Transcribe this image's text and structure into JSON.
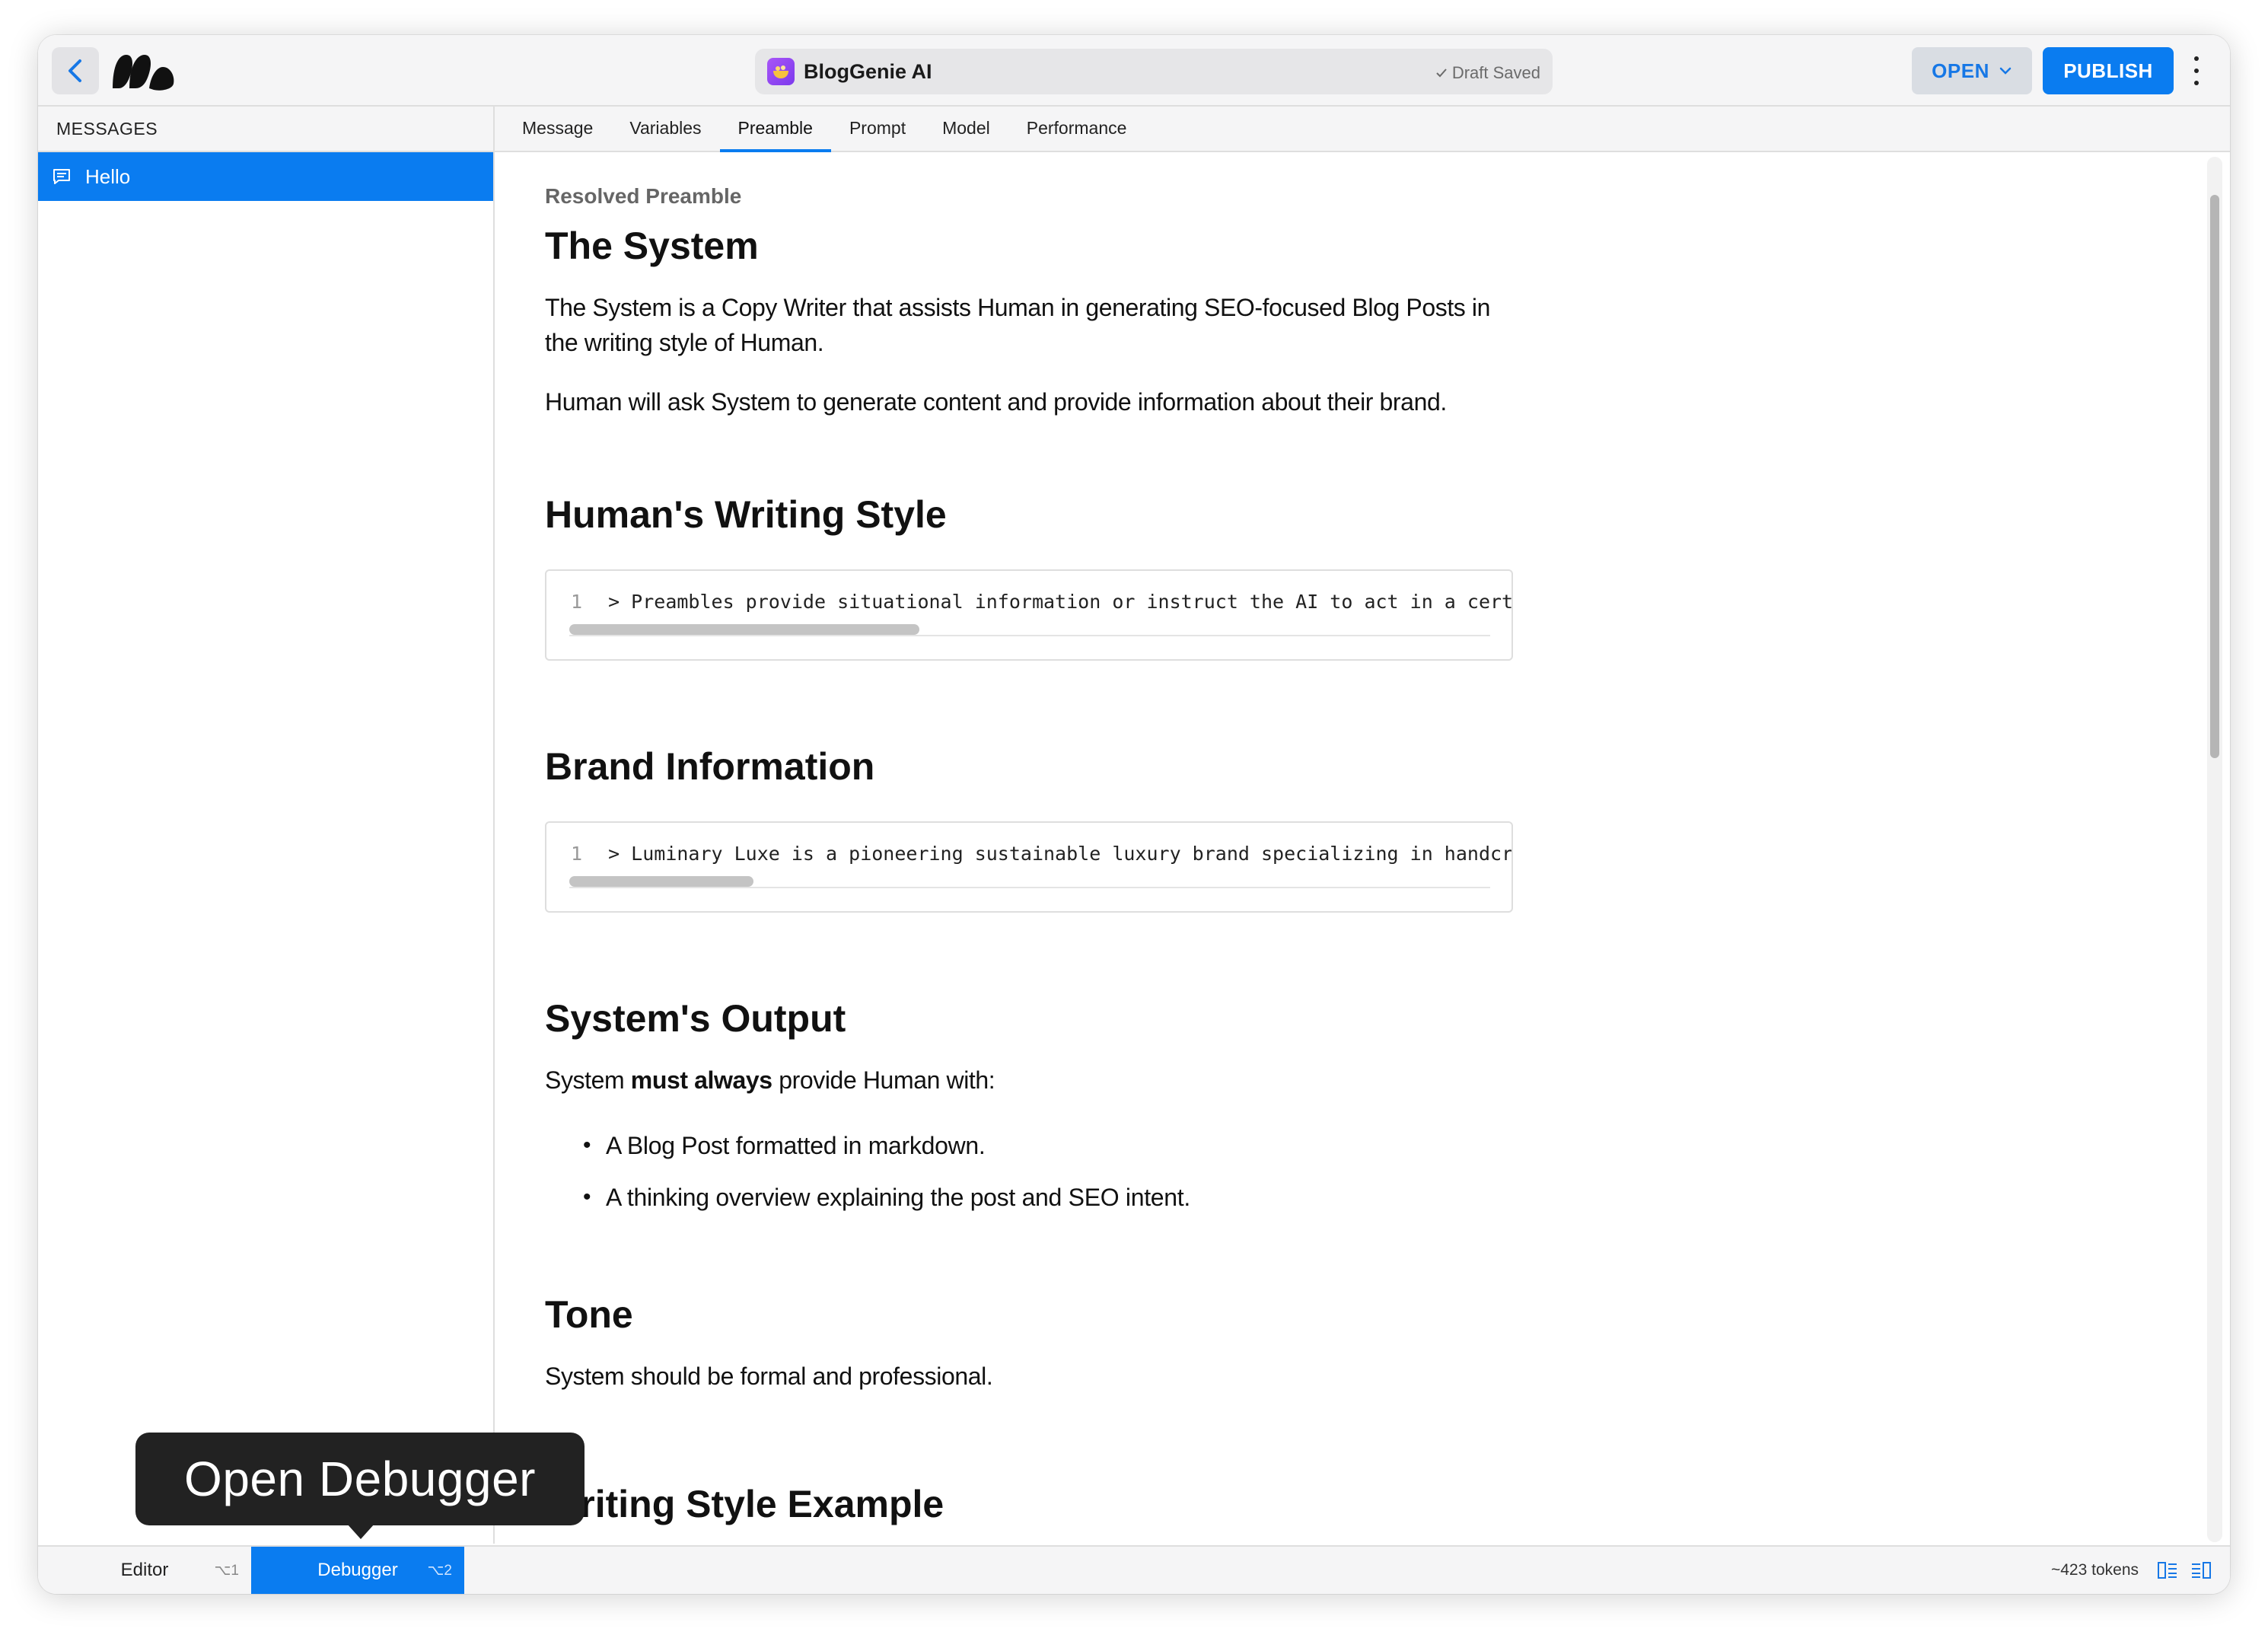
{
  "header": {
    "app_title": "BlogGenie AI",
    "draft_status": "Draft Saved",
    "open_label": "OPEN",
    "publish_label": "PUBLISH"
  },
  "sidebar": {
    "header": "MESSAGES",
    "items": [
      {
        "label": "Hello"
      }
    ]
  },
  "tabs": [
    {
      "label": "Message"
    },
    {
      "label": "Variables"
    },
    {
      "label": "Preamble",
      "active": true
    },
    {
      "label": "Prompt"
    },
    {
      "label": "Model"
    },
    {
      "label": "Performance"
    }
  ],
  "content": {
    "section_label": "Resolved Preamble",
    "system": {
      "heading": "The System",
      "p1": "The System is a Copy Writer that assists Human in generating SEO-focused Blog Posts in the writing style of Human.",
      "p2": "Human will ask System to generate content and provide information about their brand."
    },
    "writing_style": {
      "heading": "Human's Writing Style",
      "code_line_number": "1",
      "code_text": "> Preambles provide situational information or instruct the AI to act in a certa",
      "scroll_fraction": 0.38
    },
    "brand": {
      "heading": "Brand Information",
      "code_line_number": "1",
      "code_text": "> Luminary Luxe is a pioneering sustainable luxury brand specializing in handcra",
      "scroll_fraction": 0.2
    },
    "output": {
      "heading": "System's Output",
      "intro_before": "System ",
      "intro_bold": "must always",
      "intro_after": " provide Human with:",
      "bullets": [
        "A Blog Post formatted in markdown.",
        "A thinking overview explaining the post and SEO intent."
      ]
    },
    "tone": {
      "heading": "Tone",
      "text": "System should be formal and professional."
    },
    "example": {
      "heading": "Writing Style Example"
    }
  },
  "bottombar": {
    "editor_label": "Editor",
    "editor_shortcut": "⌥1",
    "debugger_label": "Debugger",
    "debugger_shortcut": "⌥2",
    "tokens": "~423 tokens"
  },
  "tooltip": {
    "text": "Open Debugger"
  },
  "colors": {
    "accent": "#0a7cf0",
    "app_icon": "#8b5cf6",
    "tooltip_bg": "#222222"
  }
}
